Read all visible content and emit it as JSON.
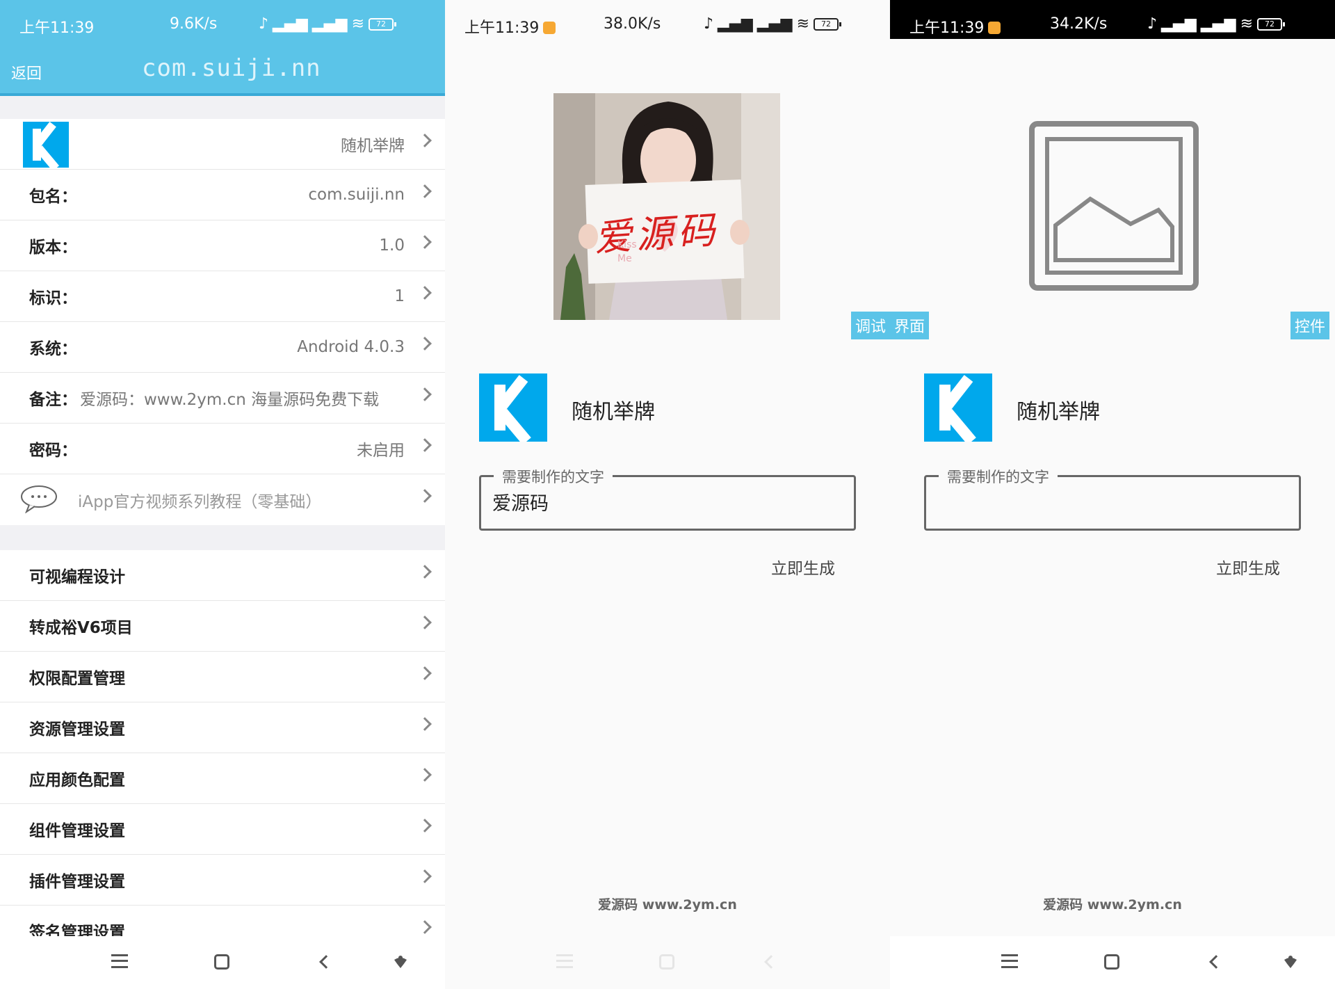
{
  "status_bars": [
    {
      "time": "上午11:39",
      "speed": "9.6K/s",
      "battery": "72"
    },
    {
      "time": "上午11:39",
      "speed": "38.0K/s",
      "battery": "72"
    },
    {
      "time": "上午11:39",
      "speed": "34.2K/s",
      "battery": "72"
    }
  ],
  "settings": {
    "back_label": "返回",
    "title": "com.suiji.nn",
    "app_row_value": "随机举牌",
    "info_rows": [
      {
        "label": "包名：",
        "value": "com.suiji.nn"
      },
      {
        "label": "版本：",
        "value": "1.0"
      },
      {
        "label": "标识：",
        "value": "1"
      },
      {
        "label": "系统：",
        "value": "Android 4.0.3"
      }
    ],
    "note_label": "备注：",
    "note_value": "爱源码：www.2ym.cn 海量源码免费下载",
    "password_label": "密码：",
    "password_value": "未启用",
    "tutorial_label": "iApp官方视频系列教程（零基础）",
    "menu_items": [
      "可视编程设计",
      "转成裕V6项目",
      "权限配置管理",
      "资源管理设置",
      "应用颜色配置",
      "组件管理设置",
      "插件管理设置",
      "签名管理设置"
    ]
  },
  "preview": {
    "photo_sign_text": "爱源码",
    "photo_sign_small": "Kiss Me",
    "debug_tag": "调试",
    "ui_tag": "界面",
    "control_tag": "控件",
    "app_name": "随机举牌",
    "field_legend": "需要制作的文字",
    "field_value_filled": "爱源码",
    "field_value_empty": "",
    "generate_label": "立即生成",
    "footer": "爱源码 www.2ym.cn"
  },
  "colors": {
    "accent": "#5bc4e8",
    "logo_blue": "#00a8ec",
    "sign_red": "#d8201f"
  }
}
